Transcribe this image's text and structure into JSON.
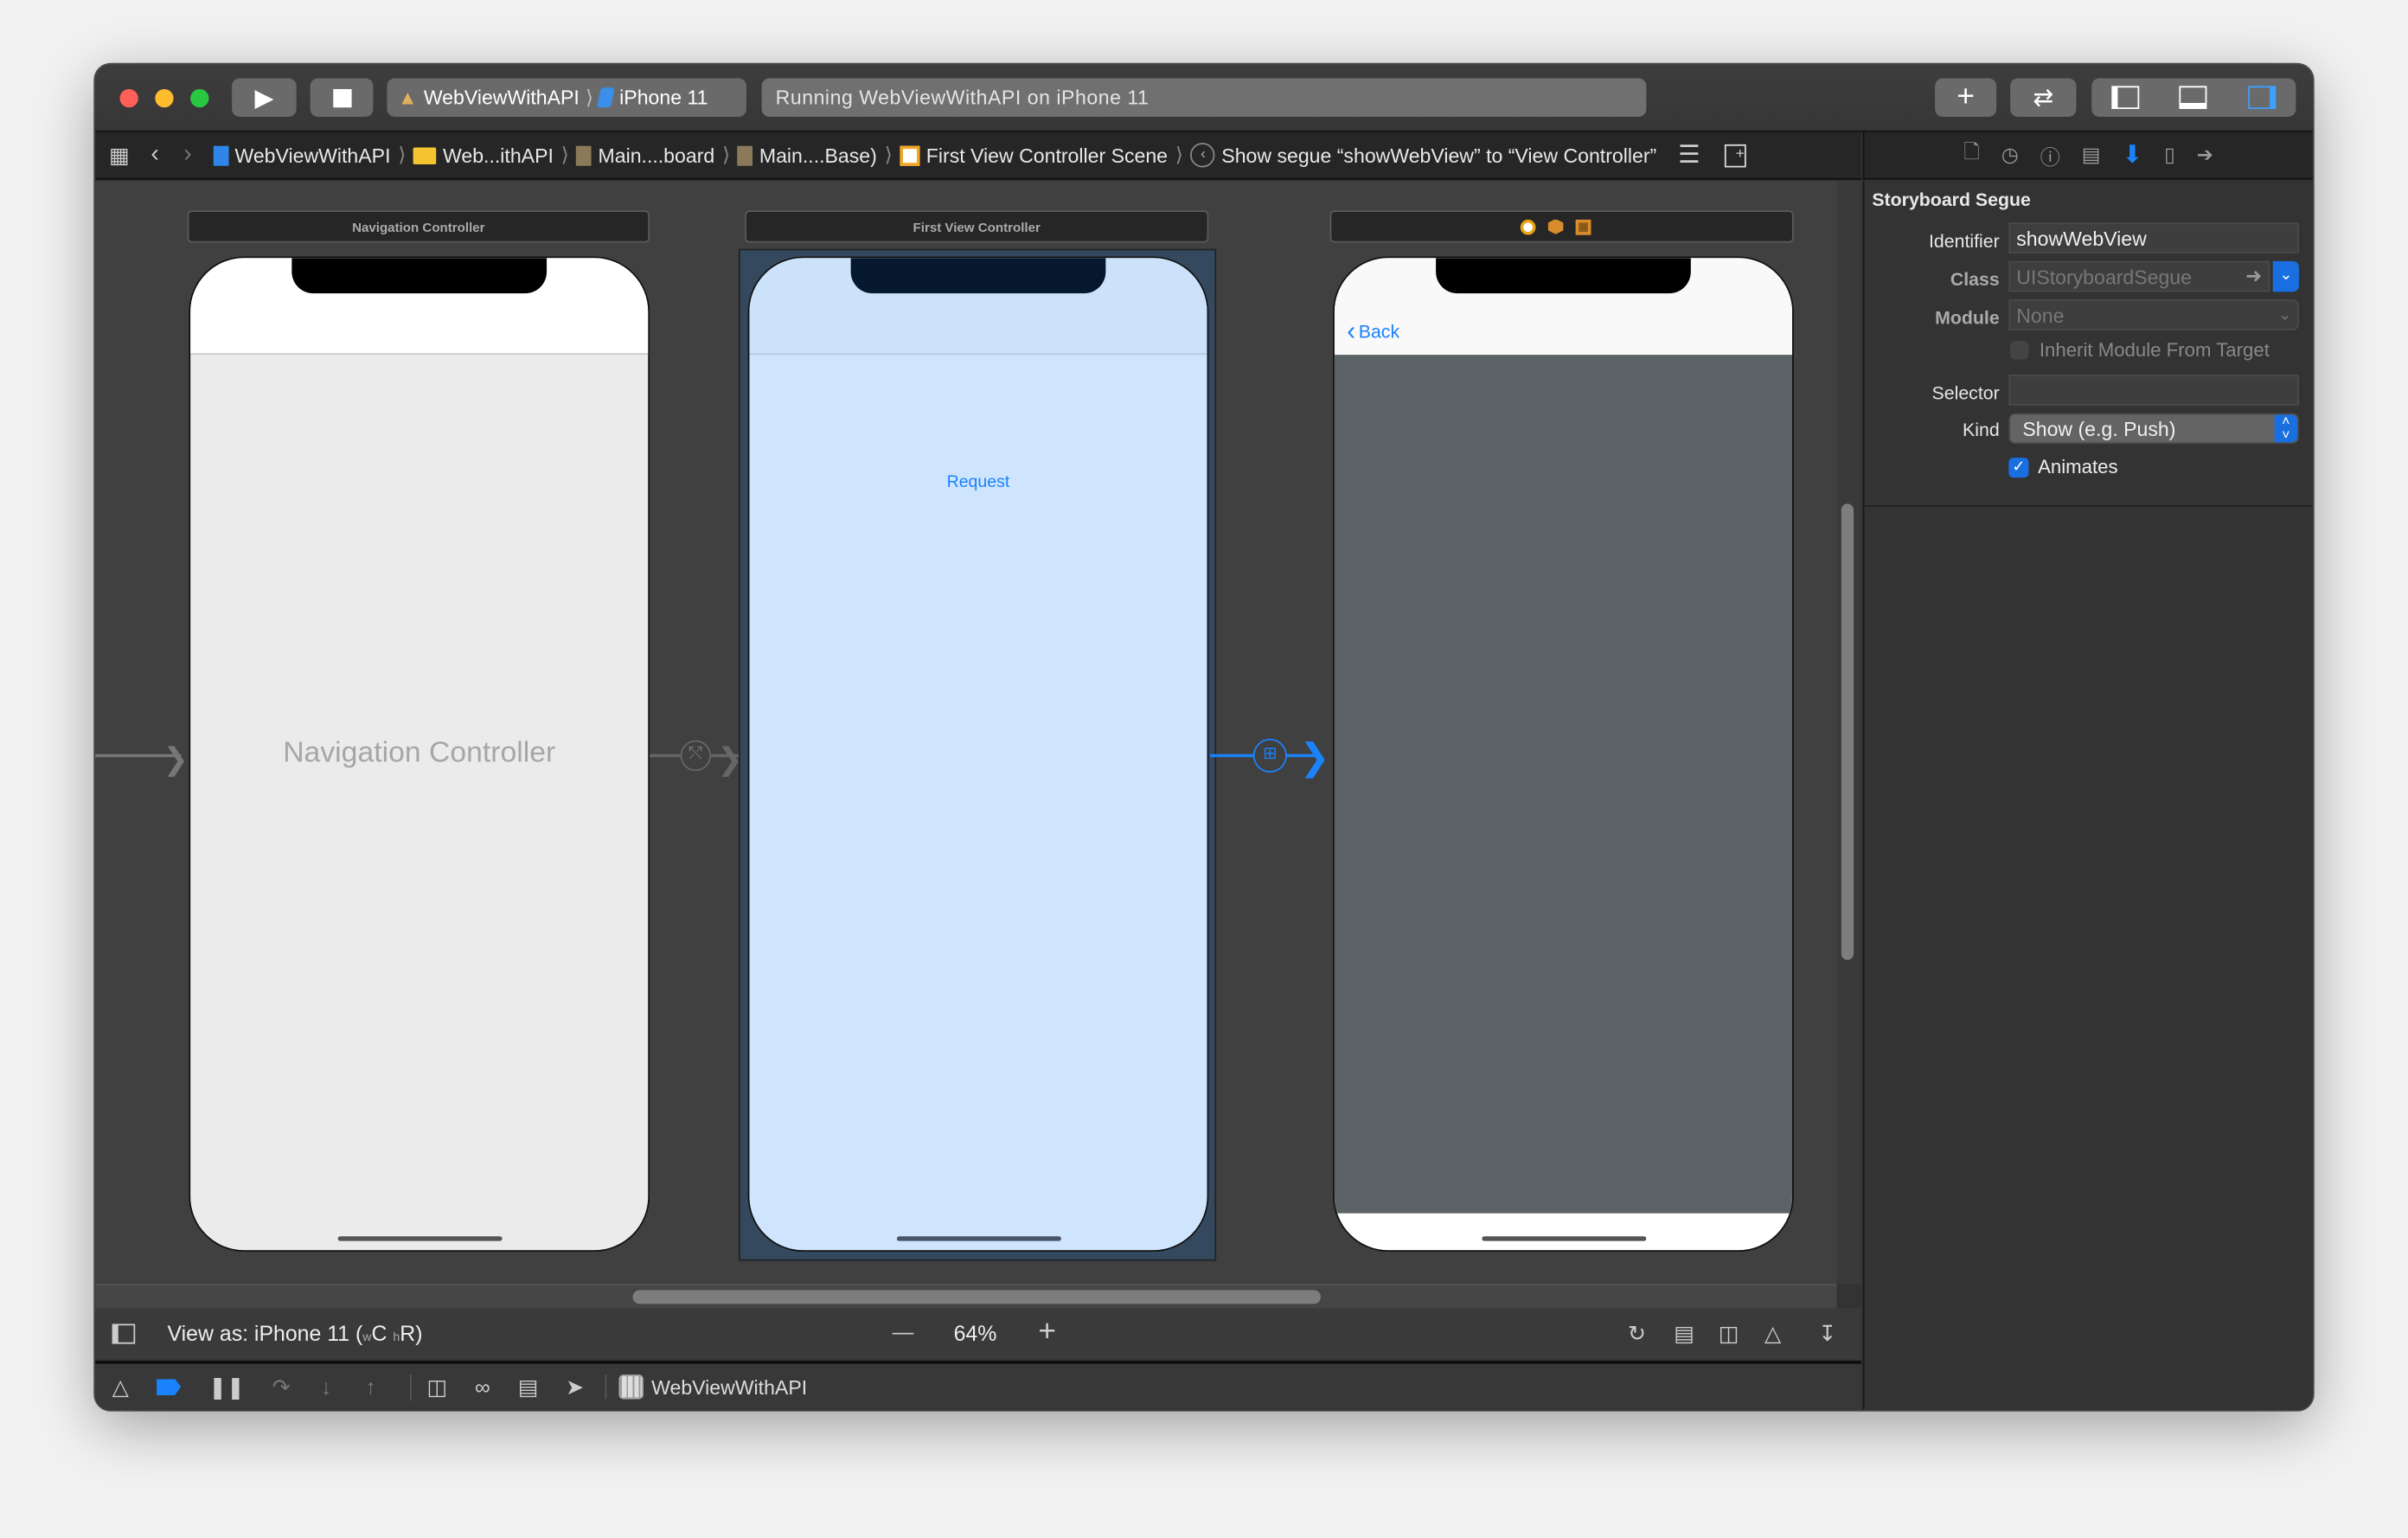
{
  "window": {
    "traffic_lights": {
      "close": "#ff5f57",
      "minimize": "#febc2e",
      "zoom": "#28c840"
    }
  },
  "toolbar": {
    "run_icon": "play-icon",
    "stop_icon": "stop-icon",
    "scheme": {
      "target": "WebViewWithAPI",
      "device": "iPhone 11"
    },
    "status": "Running WebViewWithAPI on iPhone 11",
    "right_buttons": [
      "library-plus-icon",
      "code-review-icon",
      "navigator-panel-icon",
      "debug-panel-icon",
      "inspector-panel-icon"
    ]
  },
  "breadcrumb": {
    "items": [
      "WebViewWithAPI",
      "Web...ithAPI",
      "Main....board",
      "Main....Base)",
      "First View Controller Scene",
      "Show segue “showWebView” to “View Controller”"
    ]
  },
  "canvas": {
    "scenes": [
      {
        "title": "Navigation Controller",
        "body_label": "Navigation Controller"
      },
      {
        "title": "First View Controller",
        "button_label": "Request",
        "selected": true
      },
      {
        "title": "",
        "back_label": "Back"
      }
    ],
    "accent": "#1a82fb"
  },
  "bottom_bar": {
    "view_as": "View as: iPhone 11 (",
    "size_w": "w",
    "size_c": "C",
    "size_h": "h",
    "size_r": "R)",
    "zoom": "64%",
    "zoom_out": "—",
    "zoom_in": "+"
  },
  "debug_bar": {
    "app_name": "WebViewWithAPI"
  },
  "inspector": {
    "section_title": "Storyboard Segue",
    "identifier": {
      "label": "Identifier",
      "value": "showWebView"
    },
    "class": {
      "label": "Class",
      "placeholder": "UIStoryboardSegue"
    },
    "module": {
      "label": "Module",
      "placeholder": "None"
    },
    "inherit_module": {
      "label": "Inherit Module From Target",
      "checked": false
    },
    "selector": {
      "label": "Selector",
      "value": ""
    },
    "kind": {
      "label": "Kind",
      "value": "Show (e.g. Push)"
    },
    "animates": {
      "label": "Animates",
      "checked": true
    }
  }
}
